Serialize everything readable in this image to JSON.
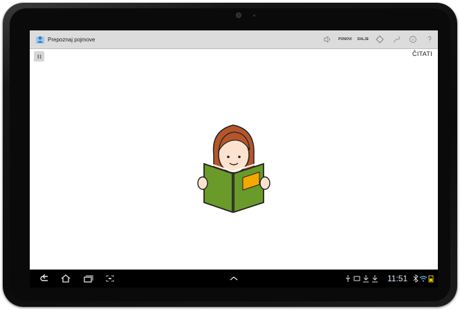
{
  "app": {
    "title": "Prepoznaj pojmove"
  },
  "actionbar": {
    "ponovi_label": "PONOVI",
    "naprijed_label": "DALJE"
  },
  "content": {
    "word": "ČITATI",
    "picture": "girl-reading-book"
  },
  "status": {
    "time": "11:51"
  },
  "colors": {
    "book_green": "#6a9a2a",
    "book_orange": "#f5a800",
    "hair": "#b5562a",
    "skin": "#fde3cf",
    "actionbar": "#dcdcdc"
  }
}
